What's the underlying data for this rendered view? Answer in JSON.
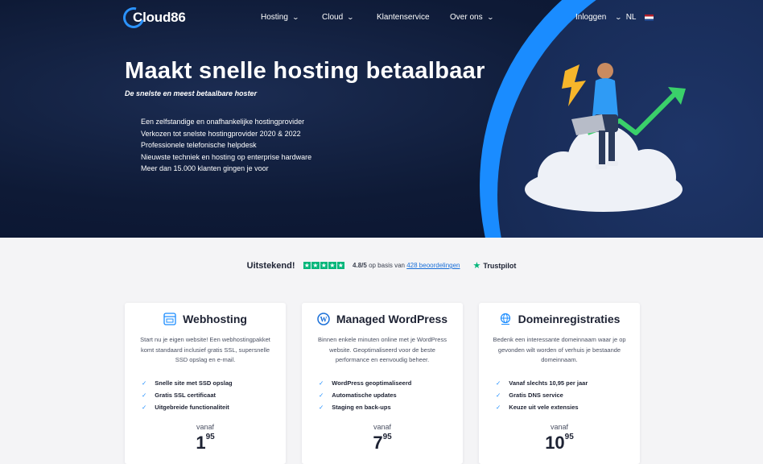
{
  "nav": {
    "brand": "Cloud86",
    "items": [
      "Hosting",
      "Cloud",
      "Klantenservice",
      "Over ons"
    ],
    "login": "Inloggen",
    "lang": "NL"
  },
  "hero": {
    "title": "Maakt snelle hosting betaalbaar",
    "subtitle": "De snelste en meest betaalbare hoster",
    "usps": [
      "Een zelfstandige en onafhankelijke hostingprovider",
      "Verkozen tot snelste hostingprovider 2020 & 2022",
      "Professionele telefonische helpdesk",
      "Nieuwste techniek en hosting op enterprise hardware",
      "Meer dan 15.000 klanten gingen je voor"
    ]
  },
  "rating": {
    "label": "Uitstekend!",
    "score": "4.8/5",
    "basis": "op basis van",
    "reviews_link": "428 beoordelingen",
    "brand": "Trustpilot"
  },
  "cards": [
    {
      "title": "Webhosting",
      "icon": "webhosting-icon",
      "desc": "Start nu je eigen website! Een webhostingpakket komt standaard inclusief gratis SSL, supersnelle SSD opslag en e-mail.",
      "features": [
        "Snelle site met SSD opslag",
        "Gratis SSL certificaat",
        "Uitgebreide functionaliteit"
      ],
      "from": "vanaf",
      "price_whole": "1",
      "price_cents": "95"
    },
    {
      "title": "Managed WordPress",
      "icon": "wordpress-icon",
      "desc": "Binnen enkele minuten online met je WordPress website. Geoptimaliseerd voor de beste performance en eenvoudig beheer.",
      "features": [
        "WordPress geoptimaliseerd",
        "Automatische updates",
        "Staging en back-ups"
      ],
      "from": "vanaf",
      "price_whole": "7",
      "price_cents": "95"
    },
    {
      "title": "Domeinregistraties",
      "icon": "globe-icon",
      "desc": "Bedenk een interessante domeinnaam waar je op gevonden wilt worden of verhuis je bestaande domeinnaam.",
      "features": [
        "Vanaf slechts 10,95 per jaar",
        "Gratis DNS service",
        "Keuze uit vele extensies"
      ],
      "from": "vanaf",
      "price_whole": "10",
      "price_cents": "95"
    }
  ],
  "colors": {
    "accent": "#1a8cff",
    "hero_bg": "#0e1a36",
    "trustpilot": "#00b67a"
  }
}
